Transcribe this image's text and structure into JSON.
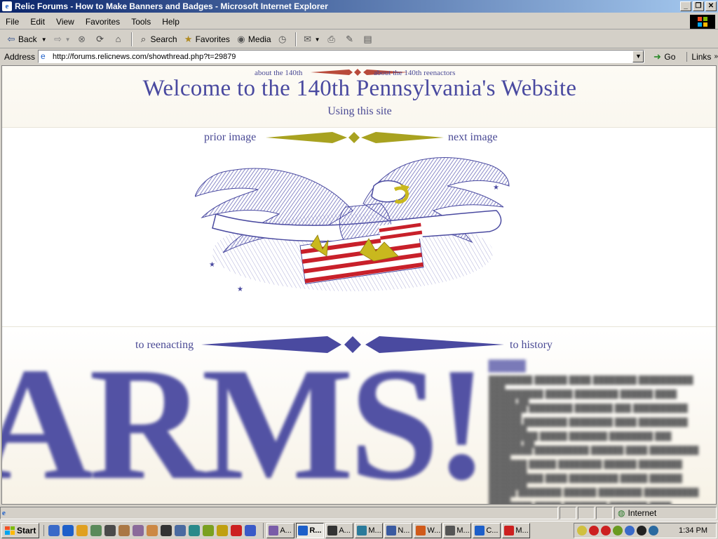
{
  "window": {
    "title": "Relic Forums - How to Make Banners and Badges - Microsoft Internet Explorer"
  },
  "menu": [
    "File",
    "Edit",
    "View",
    "Favorites",
    "Tools",
    "Help"
  ],
  "toolbar": {
    "back": "Back",
    "search": "Search",
    "favorites": "Favorites",
    "media": "Media"
  },
  "address": {
    "label": "Address",
    "url": "http://forums.relicnews.com/showthread.php?t=29879",
    "go": "Go",
    "links": "Links"
  },
  "page": {
    "nav_about": "about the 140th",
    "nav_about_reenactors": "about the 140th reenactors",
    "title": "Welcome to the 140th Pennsylvania's Website",
    "subtitle": "Using this site",
    "prior_image": "prior image",
    "next_image": "next image",
    "to_reenacting": "to reenacting",
    "to_history": "to history",
    "arms_banner": "ARMS!"
  },
  "status": {
    "zone": "Internet"
  },
  "taskbar": {
    "start": "Start",
    "clock": "1:34 PM",
    "tasks": [
      {
        "label": "A...",
        "color": "#7a5ca8"
      },
      {
        "label": "R...",
        "color": "#1d5fc9",
        "active": true
      },
      {
        "label": "A...",
        "color": "#333333"
      },
      {
        "label": "M...",
        "color": "#2a7a9a"
      },
      {
        "label": "N...",
        "color": "#3a5aa0"
      },
      {
        "label": "W...",
        "color": "#d05a1a"
      },
      {
        "label": "M...",
        "color": "#555555"
      },
      {
        "label": "C...",
        "color": "#1d5fc9"
      },
      {
        "label": "M...",
        "color": "#cc2020"
      }
    ]
  },
  "colors": {
    "title_blue": "#4a4aa0",
    "gold": "#a8a220",
    "red_banner": "#b84a3a"
  }
}
